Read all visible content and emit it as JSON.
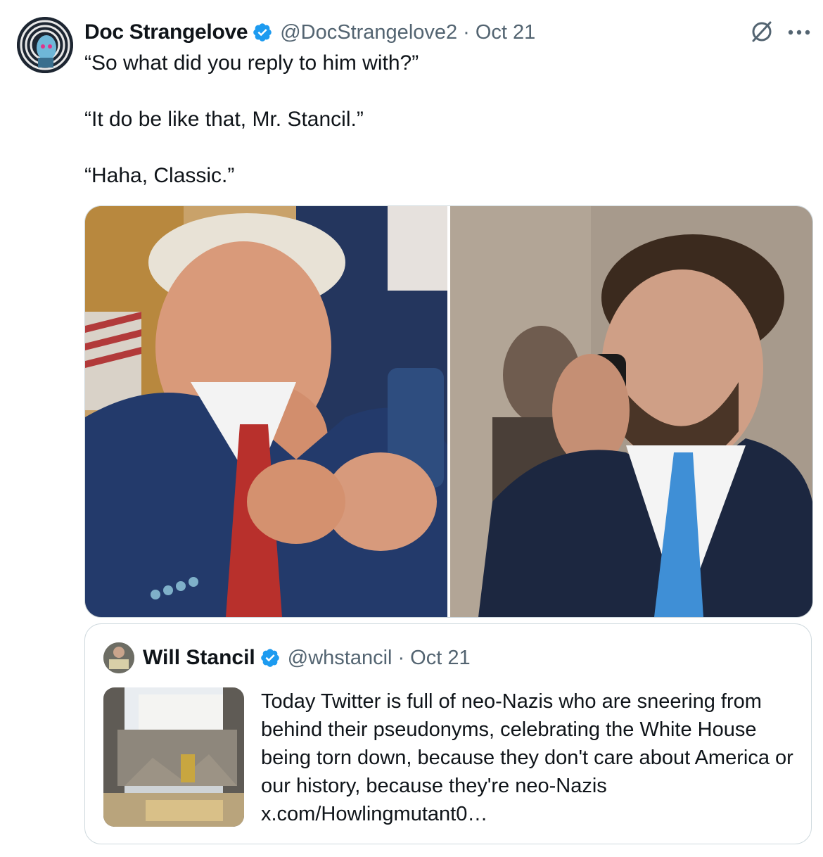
{
  "tweet": {
    "author_name": "Doc Strangelove",
    "handle": "@DocStrangelove2",
    "separator": "·",
    "date": "Oct 21",
    "text_lines": [
      "“So what did you reply to him with?”",
      "“It do be like that, Mr. Stancil.”",
      "“Haha, Classic.”"
    ],
    "media": [
      {
        "icon": "photo-man-looking-at-phone"
      },
      {
        "icon": "photo-man-on-phone-call"
      }
    ]
  },
  "quoted_tweet": {
    "author_name": "Will Stancil",
    "handle": "@whstancil",
    "separator": "·",
    "date": "Oct 21",
    "text": "Today Twitter is full of neo-Nazis who are sneering from behind their pseudonyms, celebrating the White House being torn down, because they don't care about America or our history, because they're neo-Nazis x.com/Howlingmutant0…"
  },
  "colors": {
    "text_primary": "#0f1419",
    "text_secondary": "#536471",
    "verified_blue": "#1d9bf0",
    "border": "#cfd9de"
  }
}
